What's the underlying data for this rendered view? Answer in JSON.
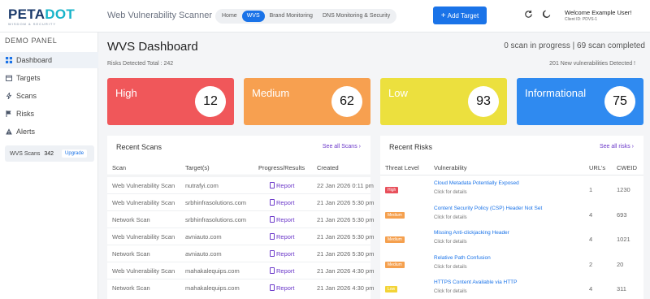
{
  "logo": {
    "main_a": "PETA",
    "main_b": "DOT",
    "sub": "Wisdom & Security"
  },
  "header": {
    "app_title": "Web Vulnerability Scanner",
    "nav": [
      "Home",
      "WVS",
      "Brand Monitoring",
      "DNS Monitoring & Security"
    ],
    "nav_active": "WVS",
    "add_target_label": "Add Target",
    "welcome": "Welcome Example User!",
    "client_id": "Client ID: PDVS-1",
    "refresh_icon": "refresh-icon",
    "theme_icon": "moon-icon"
  },
  "sidebar": {
    "title": "DEMO PANEL",
    "items": [
      {
        "label": "Dashboard",
        "icon": "grid-icon",
        "active": true
      },
      {
        "label": "Targets",
        "icon": "calendar-icon",
        "active": false
      },
      {
        "label": "Scans",
        "icon": "bolt-icon",
        "active": false
      },
      {
        "label": "Risks",
        "icon": "flag-icon",
        "active": false
      },
      {
        "label": "Alerts",
        "icon": "warning-icon",
        "active": false
      }
    ],
    "scan_box": {
      "label": "WVS Scans",
      "count": "342",
      "upgrade": "Upgrade"
    }
  },
  "main": {
    "title": "WVS Dashboard",
    "scan_status": "0 scan in progress  |  69 scan completed",
    "risks_total": "Risks Detected Total : 242",
    "new_vulns": "201 New vulnerabilities Detected !"
  },
  "cards": [
    {
      "label": "High",
      "value": "12",
      "color": "#f0575a"
    },
    {
      "label": "Medium",
      "value": "62",
      "color": "#f7a050"
    },
    {
      "label": "Low",
      "value": "93",
      "color": "#ece03e"
    },
    {
      "label": "Informational",
      "value": "75",
      "color": "#2f8af0"
    }
  ],
  "recent_scans": {
    "title": "Recent Scans",
    "link": "See all Scans",
    "headers": [
      "Scan",
      "Target(s)",
      "Progress/Results",
      "Created"
    ],
    "rows": [
      {
        "scan": "Web Vulnerability Scan",
        "target": "nutrafyi.com",
        "result": "Report",
        "created": "22 Jan 2026 0:11 pm"
      },
      {
        "scan": "Web Vulnerability Scan",
        "target": "srbhinfrasolutions.com",
        "result": "Report",
        "created": "21 Jan 2026 5:30 pm"
      },
      {
        "scan": "Network Scan",
        "target": "srbhinfrasolutions.com",
        "result": "Report",
        "created": "21 Jan 2026 5:30 pm"
      },
      {
        "scan": "Web Vulnerability Scan",
        "target": "avniauto.com",
        "result": "Report",
        "created": "21 Jan 2026 5:30 pm"
      },
      {
        "scan": "Network Scan",
        "target": "avniauto.com",
        "result": "Report",
        "created": "21 Jan 2026 5:30 pm"
      },
      {
        "scan": "Web Vulnerability Scan",
        "target": "mahakalequips.com",
        "result": "Report",
        "created": "21 Jan 2026 4:30 pm"
      },
      {
        "scan": "Network Scan",
        "target": "mahakalequips.com",
        "result": "Report",
        "created": "21 Jan 2026 4:30 pm"
      }
    ]
  },
  "recent_risks": {
    "title": "Recent Risks",
    "link": "See all risks",
    "headers": [
      "Threat Level",
      "Vulnerability",
      "URL's",
      "CWEID"
    ],
    "rows": [
      {
        "level": "High",
        "level_color": "#e8505b",
        "name": "Cloud Metadata Potentially Exposed",
        "sub": "Click for details",
        "urls": "1",
        "cweid": "1230"
      },
      {
        "level": "Medium",
        "level_color": "#f5a04e",
        "name": "Content Security Policy (CSP) Header Not Set",
        "sub": "Click for details",
        "urls": "4",
        "cweid": "693"
      },
      {
        "level": "Medium",
        "level_color": "#f5a04e",
        "name": "Missing Anti-clickjacking Header",
        "sub": "Click for details",
        "urls": "4",
        "cweid": "1021"
      },
      {
        "level": "Medium",
        "level_color": "#f5a04e",
        "name": "Relative Path Confusion",
        "sub": "Click for details",
        "urls": "2",
        "cweid": "20"
      },
      {
        "level": "Low",
        "level_color": "#f3d437",
        "name": "HTTPS Content Available via HTTP",
        "sub": "Click for details",
        "urls": "4",
        "cweid": "311"
      }
    ]
  }
}
